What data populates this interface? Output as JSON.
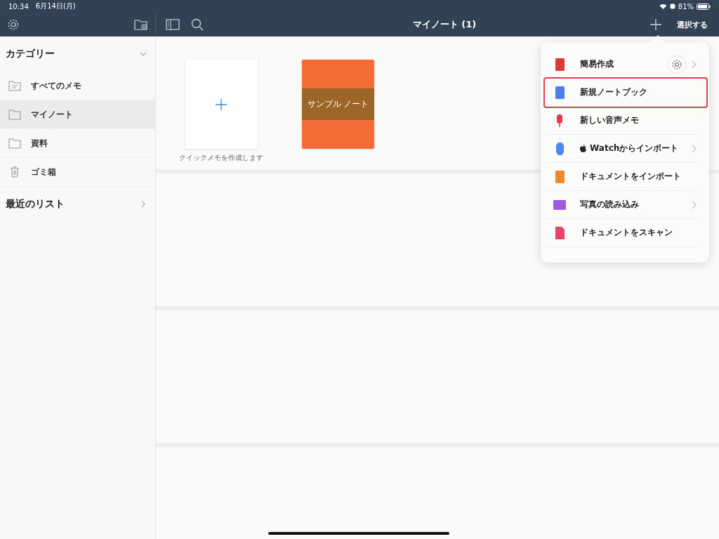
{
  "status_bar": {
    "time": "10:34",
    "date": "6月14日(月)",
    "battery": "81%"
  },
  "nav_bar": {
    "title": "マイノート (1)",
    "select_button": "選択する"
  },
  "sidebar": {
    "sections": [
      {
        "title": "カテゴリー",
        "expanded": true,
        "items": [
          {
            "label": "すべてのメモ",
            "kind": "notes",
            "selected": false
          },
          {
            "label": "マイノート",
            "kind": "folder",
            "selected": true
          },
          {
            "label": "資料",
            "kind": "folder",
            "selected": false
          },
          {
            "label": "ゴミ箱",
            "kind": "trash",
            "selected": false
          }
        ]
      },
      {
        "title": "最近のリスト",
        "expanded": false
      }
    ]
  },
  "shelf": {
    "quick_memo_caption": "クイックメモを作成します",
    "notebooks": [
      {
        "title": "サンプル ノート",
        "color": "#f46b35"
      }
    ]
  },
  "add_menu": {
    "items": [
      {
        "label": "簡易作成",
        "kind": "quick",
        "color": "#d93a3a",
        "chevron": true,
        "settings": true,
        "highlighted": false,
        "apple_logo": false
      },
      {
        "label": "新規ノートブック",
        "kind": "notebook",
        "color": "#4f7de8",
        "chevron": false,
        "settings": false,
        "highlighted": true,
        "apple_logo": false
      },
      {
        "label": "新しい音声メモ",
        "kind": "mic",
        "color": "#e8354b",
        "chevron": false,
        "settings": false,
        "highlighted": false,
        "apple_logo": false
      },
      {
        "label": "Watchからインポート",
        "kind": "watch",
        "color": "#4f86ee",
        "chevron": true,
        "settings": false,
        "highlighted": false,
        "apple_logo": true
      },
      {
        "label": "ドキュメントをインポート",
        "kind": "import",
        "color": "#f0892a",
        "chevron": false,
        "settings": false,
        "highlighted": false,
        "apple_logo": false
      },
      {
        "label": "写真の読み込み",
        "kind": "photo",
        "color": "#a05ae0",
        "chevron": true,
        "settings": false,
        "highlighted": false,
        "apple_logo": false
      },
      {
        "label": "ドキュメントをスキャン",
        "kind": "scan",
        "color": "#e8456a",
        "chevron": false,
        "settings": false,
        "highlighted": false,
        "apple_logo": false
      }
    ]
  }
}
